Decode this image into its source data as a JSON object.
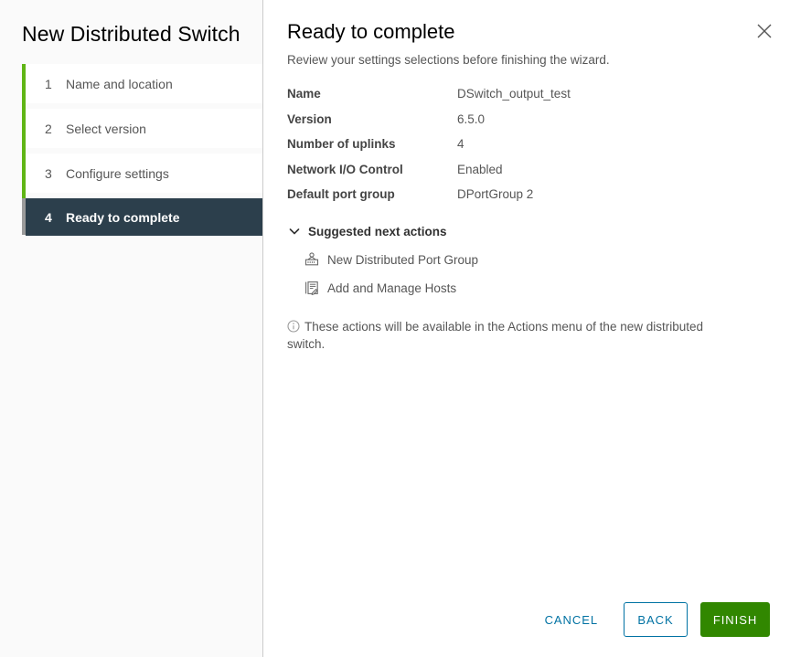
{
  "wizard": {
    "title": "New Distributed Switch",
    "steps": [
      {
        "number": "1",
        "label": "Name and location",
        "active": false
      },
      {
        "number": "2",
        "label": "Select version",
        "active": false
      },
      {
        "number": "3",
        "label": "Configure settings",
        "active": false
      },
      {
        "number": "4",
        "label": "Ready to complete",
        "active": true
      }
    ]
  },
  "page": {
    "title": "Ready to complete",
    "subtitle": "Review your settings selections before finishing the wizard.",
    "close_icon": "close-icon"
  },
  "summary": {
    "rows": [
      {
        "label": "Name",
        "value": "DSwitch_output_test"
      },
      {
        "label": "Version",
        "value": "6.5.0"
      },
      {
        "label": "Number of uplinks",
        "value": "4"
      },
      {
        "label": "Network I/O Control",
        "value": "Enabled"
      },
      {
        "label": "Default port group",
        "value": "DPortGroup 2"
      }
    ]
  },
  "suggested_actions": {
    "header": "Suggested next actions",
    "chevron_icon": "chevron-down-icon",
    "items": [
      {
        "label": "New Distributed Port Group",
        "icon": "distributed-port-group-icon"
      },
      {
        "label": "Add and Manage Hosts",
        "icon": "add-manage-hosts-icon"
      }
    ]
  },
  "note": {
    "icon": "info-circle-icon",
    "text": "These actions will be available in the Actions menu of the new distributed switch."
  },
  "footer": {
    "cancel_label": "CANCEL",
    "back_label": "BACK",
    "finish_label": "FINISH"
  },
  "colors": {
    "progress_green": "#60b515",
    "active_step_bg": "#2c3f4c",
    "action_blue": "#0072a3",
    "finish_green": "#318700"
  }
}
